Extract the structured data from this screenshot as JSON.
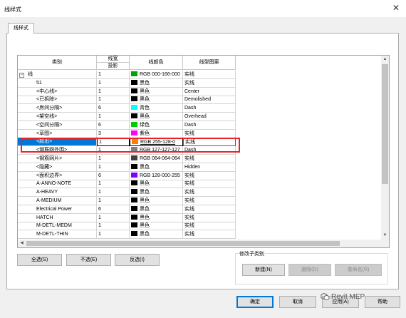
{
  "window": {
    "title": "线样式",
    "close_icon": "✕"
  },
  "tab": {
    "label": "线样式"
  },
  "table": {
    "columns": [
      {
        "label": "类别"
      },
      {
        "label": "线宽",
        "sub": "投影"
      },
      {
        "label": "线颜色"
      },
      {
        "label": "线型图案"
      }
    ],
    "rows": [
      {
        "category": "线",
        "width": "1",
        "color_hex": "#00a600",
        "color_label": "RGB 000-166-000",
        "pattern": "实线",
        "expander": "−"
      },
      {
        "category": "51",
        "width": "1",
        "color_hex": "#000000",
        "color_label": "黑色",
        "pattern": "实线"
      },
      {
        "category": "<中心线>",
        "width": "1",
        "color_hex": "#000000",
        "color_label": "黑色",
        "pattern": "Center"
      },
      {
        "category": "<已拆除>",
        "width": "1",
        "color_hex": "#000000",
        "color_label": "黑色",
        "pattern": "Demolished"
      },
      {
        "category": "<房间分隔>",
        "width": "6",
        "color_hex": "#00ffff",
        "color_label": "青色",
        "pattern": "Dash"
      },
      {
        "category": "<架空线>",
        "width": "1",
        "color_hex": "#000000",
        "color_label": "黑色",
        "pattern": "Overhead"
      },
      {
        "category": "<空间分隔>",
        "width": "6",
        "color_hex": "#00cc00",
        "color_label": "绿色",
        "pattern": "Dash"
      },
      {
        "category": "<草图>",
        "width": "3",
        "color_hex": "#ff00ff",
        "color_label": "紫色",
        "pattern": "实线"
      },
      {
        "category": "<超出>",
        "width": "1",
        "color_hex": "#ff8000",
        "color_label": "RGB 255-128-0",
        "pattern": "实线",
        "selected": true
      },
      {
        "category": "<钢筋网外围>",
        "width": "1",
        "color_hex": "#7f7f7f",
        "color_label": "RGB 127-127-127",
        "pattern": "Dash"
      },
      {
        "category": "<钢筋网片>",
        "width": "1",
        "color_hex": "#404040",
        "color_label": "RGB 064-064-064",
        "pattern": "实线"
      },
      {
        "category": "<隐藏>",
        "width": "1",
        "color_hex": "#000000",
        "color_label": "黑色",
        "pattern": "Hidden"
      },
      {
        "category": "<面积边界>",
        "width": "6",
        "color_hex": "#8000ff",
        "color_label": "RGB 128-000-255",
        "pattern": "实线"
      },
      {
        "category": "A-ANNO-NOTE",
        "width": "1",
        "color_hex": "#000000",
        "color_label": "黑色",
        "pattern": "实线"
      },
      {
        "category": "A-HEAVY",
        "width": "1",
        "color_hex": "#000000",
        "color_label": "黑色",
        "pattern": "实线"
      },
      {
        "category": "A-MEDIUM",
        "width": "1",
        "color_hex": "#000000",
        "color_label": "黑色",
        "pattern": "实线"
      },
      {
        "category": "Electrical Power",
        "width": "6",
        "color_hex": "#000000",
        "color_label": "黑色",
        "pattern": "实线"
      },
      {
        "category": "HATCH",
        "width": "1",
        "color_hex": "#000000",
        "color_label": "黑色",
        "pattern": "实线"
      },
      {
        "category": "M-DETL-MEDM",
        "width": "1",
        "color_hex": "#000000",
        "color_label": "黑色",
        "pattern": "实线"
      },
      {
        "category": "M-DETL-THIN",
        "width": "1",
        "color_hex": "#000000",
        "color_label": "黑色",
        "pattern": "实线"
      }
    ]
  },
  "buttons": {
    "select_all": "全选(S)",
    "select_none": "不选(E)",
    "invert": "反选(I)"
  },
  "subcategory": {
    "label": "修改子类别",
    "new": "新建(N)",
    "delete": "删除(D)",
    "rename": "重命名(R)"
  },
  "footer": {
    "ok": "确定",
    "cancel": "取消",
    "apply": "应用(A)",
    "help": "帮助"
  },
  "watermark": {
    "text": "Revit MEP"
  },
  "colors": {
    "selection": "#0078d7",
    "annotation_box": "#e8232a"
  }
}
